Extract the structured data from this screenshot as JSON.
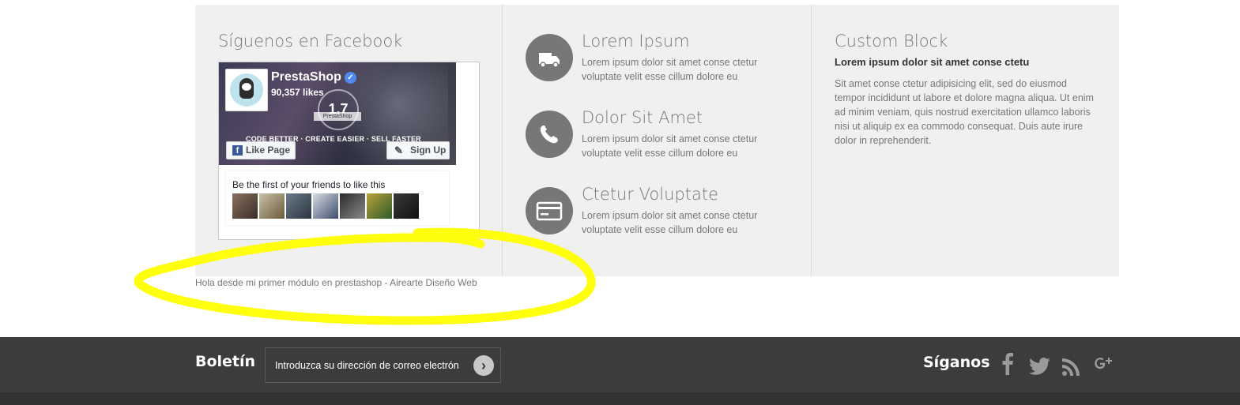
{
  "facebook_block": {
    "title": "Síguenos en Facebook",
    "page_name": "PrestaShop",
    "likes": "90,357 likes",
    "badge_number": "1.7",
    "badge_label": "PrestaShop",
    "tagline": "CODE BETTER · CREATE EASIER · SELL FASTER",
    "like_button": "Like Page",
    "signup_button": "Sign Up",
    "friends_text": "Be the first of your friends to like this",
    "verified_mark": "✓"
  },
  "features": [
    {
      "title": "Lorem Ipsum",
      "text": "Lorem ipsum dolor sit amet conse ctetur voluptate velit esse cillum dolore eu",
      "icon": "truck-icon"
    },
    {
      "title": "Dolor Sit Amet",
      "text": "Lorem ipsum dolor sit amet conse ctetur voluptate velit esse cillum dolore eu",
      "icon": "phone-icon"
    },
    {
      "title": "Ctetur Voluptate",
      "text": "Lorem ipsum dolor sit amet conse ctetur voluptate velit esse cillum dolore eu",
      "icon": "credit-card-icon"
    }
  ],
  "custom_block": {
    "title": "Custom Block",
    "subtitle": "Lorem ipsum dolor sit amet conse ctetu",
    "text": "Sit amet conse ctetur adipisicing elit, sed do eiusmod tempor incididunt ut labore et dolore magna aliqua. Ut enim ad minim veniam, quis nostrud exercitation ullamco laboris nisi ut aliquip ex ea commodo consequat. Duis aute irure dolor in reprehenderit."
  },
  "module_message": "Hola desde mi primer módulo en prestashop - Airearte Diseño Web",
  "footer": {
    "newsletter_title": "Boletín",
    "newsletter_placeholder": "Introduzca su dirección de correo electrón",
    "submit_glyph": "›",
    "follow_title": "Síganos",
    "social": [
      "facebook-icon",
      "twitter-icon",
      "rss-icon",
      "google-plus-icon"
    ]
  },
  "colors": {
    "panel_bg": "#f0f0f0",
    "footer_bg": "#3c3c3c",
    "highlight": "#ffff00",
    "icon_circle": "#777777"
  }
}
